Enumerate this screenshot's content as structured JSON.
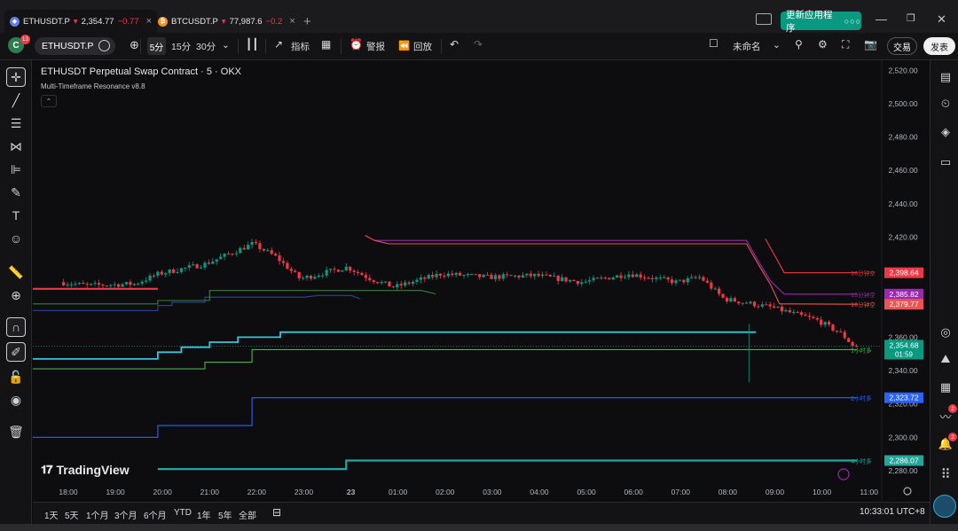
{
  "browser_tabs": [
    {
      "symbol": "ETHUSDT.P",
      "price": "2,354.77",
      "change": "−0.77",
      "coin": "ETH",
      "coin_color": "#627eea",
      "active": true
    },
    {
      "symbol": "BTCUSDT.P",
      "price": "77,987.6",
      "change": "−0.2",
      "coin": "BTC",
      "coin_color": "#f7931a",
      "active": false
    }
  ],
  "update_button": {
    "label": "更新应用程序"
  },
  "toolbar": {
    "avatar_letter": "C",
    "notification_count": "13",
    "symbol": "ETHUSDT.P",
    "intervals": [
      "5分",
      "15分",
      "30分"
    ],
    "indicators_label": "指标",
    "alert_label": "警报",
    "replay_label": "回放",
    "layout_name": "未命名",
    "trade_label": "交易",
    "publish_label": "发表"
  },
  "chart_header": {
    "title": "ETHUSDT Perpetual Swap Contract · 5 · OKX",
    "indicator": "Multi-Timeframe Resonance v8.8"
  },
  "logo_text": "TradingView",
  "price_axis_ticks": [
    "2,520.00",
    "2,500.00",
    "2,480.00",
    "2,460.00",
    "2,440.00",
    "2,420.00",
    "2,360.00",
    "2,340.00",
    "2,320.00",
    "2,300.00",
    "2,280.00"
  ],
  "time_axis_ticks": [
    "18:00",
    "19:00",
    "20:00",
    "21:00",
    "22:00",
    "23:00",
    "23",
    "01:00",
    "02:00",
    "03:00",
    "04:00",
    "05:00",
    "06:00",
    "07:00",
    "08:00",
    "09:00",
    "10:00",
    "11:00"
  ],
  "level_labels": [
    {
      "label": "10分钟空",
      "price": "2,398.64",
      "color": "#f23645"
    },
    {
      "label": "15分钟空",
      "price": "2,385.82",
      "color": "#9c27b0"
    },
    {
      "label": "10分钟空",
      "price": "2,379.77",
      "color": "#ef5350"
    },
    {
      "label": "1小时多",
      "price": "2,352.54",
      "color": "#4caf50"
    },
    {
      "label": "2小时多",
      "price": "2,323.72",
      "color": "#2962ff"
    },
    {
      "label": "4小时多",
      "price": "2,286.07",
      "color": "#26a69a"
    }
  ],
  "current_price": {
    "price": "2,354.68",
    "countdown": "01:59",
    "color": "#089981"
  },
  "chart_data": {
    "type": "candlestick",
    "ylim": [
      2272,
      2526
    ],
    "x_ticks": [
      "18:00",
      "19:00",
      "20:00",
      "21:00",
      "22:00",
      "23:00",
      "23",
      "01:00",
      "02:00",
      "03:00",
      "04:00",
      "05:00",
      "06:00",
      "07:00",
      "08:00",
      "09:00",
      "10:00",
      "11:00"
    ],
    "key_path_time_price": [
      [
        17.9,
        2393
      ],
      [
        18.5,
        2391
      ],
      [
        19.5,
        2392
      ],
      [
        20.0,
        2398
      ],
      [
        21.0,
        2404
      ],
      [
        21.5,
        2410
      ],
      [
        22.0,
        2416
      ],
      [
        22.5,
        2408
      ],
      [
        23.0,
        2395
      ],
      [
        24.0,
        2402
      ],
      [
        24.5,
        2395
      ],
      [
        25.0,
        2390
      ],
      [
        26.0,
        2398
      ],
      [
        27.0,
        2396
      ],
      [
        28.0,
        2397
      ],
      [
        29.0,
        2393
      ],
      [
        30.0,
        2398
      ],
      [
        31.0,
        2393
      ],
      [
        31.5,
        2396
      ],
      [
        32.0,
        2383
      ],
      [
        33.0,
        2378
      ],
      [
        34.0,
        2370
      ],
      [
        34.5,
        2362
      ],
      [
        34.75,
        2354.77
      ]
    ],
    "series": [
      {
        "name": "10分钟空",
        "color": "#f23645",
        "steps": [
          [
            32.8,
            2419
          ],
          [
            33.2,
            2398.64
          ],
          [
            34.75,
            2398.64
          ]
        ]
      },
      {
        "name": "15分钟空",
        "color": "#9c27b0",
        "steps": [
          [
            24.5,
            2418
          ],
          [
            32.4,
            2418
          ],
          [
            32.6,
            2408
          ],
          [
            32.9,
            2394
          ],
          [
            33.2,
            2385.82
          ],
          [
            34.75,
            2385.82
          ]
        ]
      },
      {
        "name": "10分钟空",
        "color": "#ef5350",
        "steps": [
          [
            24.3,
            2421
          ],
          [
            24.5,
            2418
          ],
          [
            24.8,
            2416
          ],
          [
            32.4,
            2416
          ],
          [
            32.6,
            2406
          ],
          [
            32.9,
            2392
          ],
          [
            33.1,
            2380
          ],
          [
            34.75,
            2379.77
          ]
        ]
      },
      {
        "name": "1小时多",
        "color": "#4caf50",
        "steps": [
          [
            17.0,
            2341
          ],
          [
            20.9,
            2341
          ],
          [
            20.9,
            2345
          ],
          [
            21.9,
            2345
          ],
          [
            21.9,
            2352.54
          ],
          [
            34.75,
            2352.54
          ]
        ]
      },
      {
        "name": "2小时多",
        "color": "#2962ff",
        "steps": [
          [
            17.0,
            2300
          ],
          [
            19.9,
            2300
          ],
          [
            19.9,
            2307
          ],
          [
            21.9,
            2307
          ],
          [
            21.9,
            2323.72
          ],
          [
            34.75,
            2323.72
          ]
        ]
      },
      {
        "name": "4小时多",
        "color": "#26a69a",
        "steps": [
          [
            19.9,
            2281
          ],
          [
            23.9,
            2281
          ],
          [
            23.9,
            2286.07
          ],
          [
            34.75,
            2286.07
          ]
        ]
      },
      {
        "color": "#33c6da",
        "steps": [
          [
            17.0,
            2347
          ],
          [
            19.9,
            2347
          ],
          [
            19.9,
            2351
          ],
          [
            20.4,
            2351
          ],
          [
            20.4,
            2354
          ],
          [
            21.0,
            2354
          ],
          [
            21.0,
            2357
          ],
          [
            21.6,
            2357
          ],
          [
            21.6,
            2360
          ],
          [
            22.5,
            2360
          ],
          [
            22.5,
            2363
          ],
          [
            32.4,
            2363
          ],
          [
            32.6,
            2363
          ]
        ]
      },
      {
        "color": "#3b5bdb",
        "steps": [
          [
            17.0,
            2376
          ],
          [
            19.9,
            2376
          ],
          [
            19.9,
            2379
          ],
          [
            20.2,
            2379
          ],
          [
            20.2,
            2381
          ],
          [
            20.9,
            2381
          ],
          [
            20.9,
            2384
          ],
          [
            23.0,
            2384
          ],
          [
            23.3,
            2385
          ],
          [
            24.0,
            2385
          ],
          [
            24.2,
            2383
          ]
        ]
      },
      {
        "color": "#4caf50",
        "steps": [
          [
            17.0,
            2380
          ],
          [
            19.9,
            2380
          ],
          [
            19.9,
            2382
          ],
          [
            21.0,
            2382
          ],
          [
            21.0,
            2388
          ],
          [
            25.5,
            2388
          ],
          [
            25.8,
            2386
          ]
        ]
      },
      {
        "color": "#f23645",
        "steps": [
          [
            17.0,
            2389
          ],
          [
            19.9,
            2389
          ]
        ]
      }
    ],
    "candle_colors": {
      "up": "#089981",
      "down": "#f23645"
    }
  },
  "bottom": {
    "ranges": [
      "1天",
      "5天",
      "1个月",
      "3个月",
      "6个月",
      "YTD",
      "1年",
      "5年",
      "全部"
    ],
    "clock": "10:33:01 UTC+8"
  },
  "right_badges": [
    "2",
    "2"
  ]
}
